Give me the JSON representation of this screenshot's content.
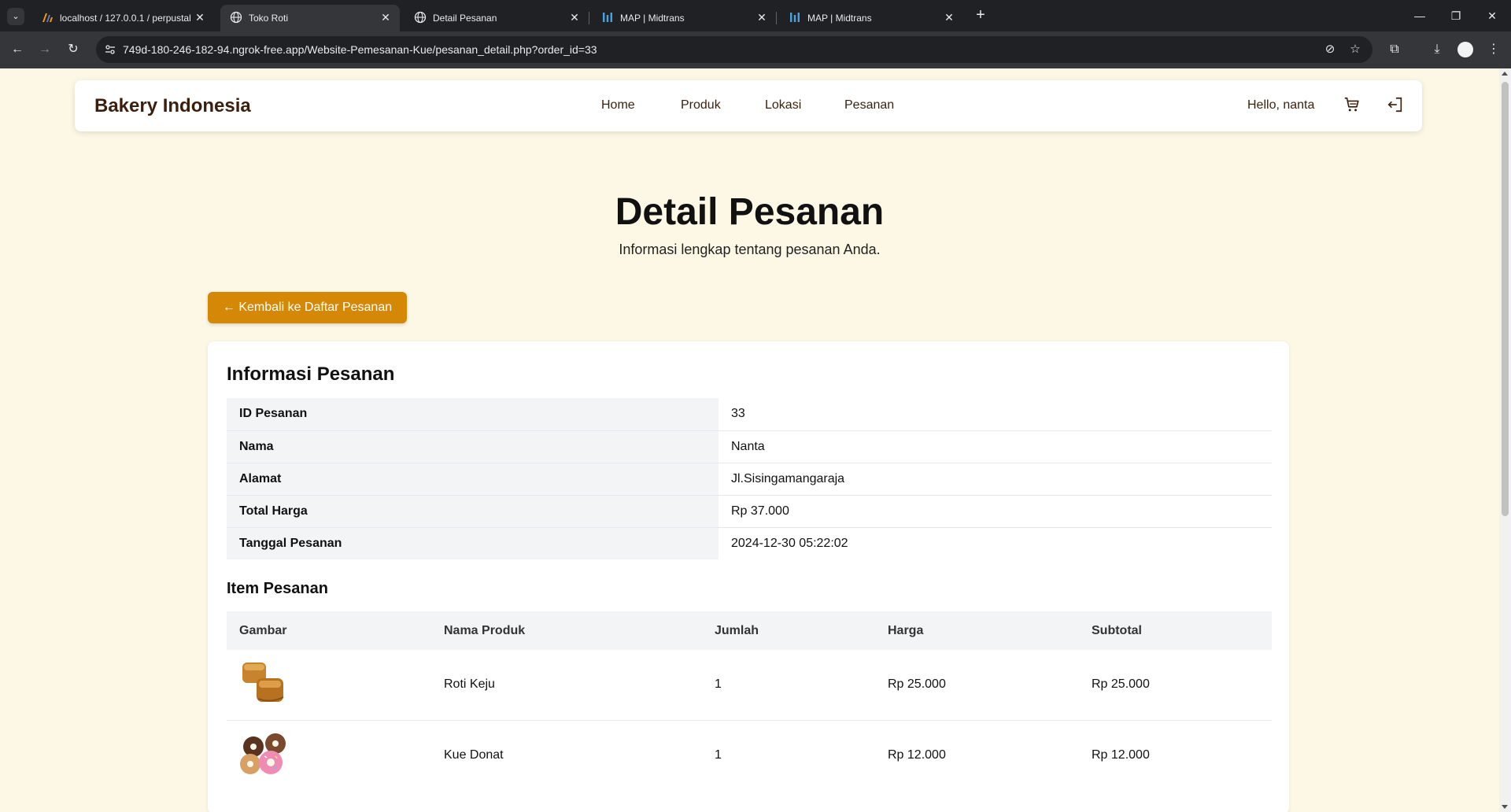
{
  "browser": {
    "tabs": [
      {
        "title": "localhost / 127.0.0.1 / perpustal",
        "active": false
      },
      {
        "title": "Toko Roti",
        "active": true
      },
      {
        "title": "Detail Pesanan",
        "active": false
      },
      {
        "title": "MAP | Midtrans",
        "active": false
      },
      {
        "title": "MAP | Midtrans",
        "active": false
      }
    ],
    "url": "749d-180-246-182-94.ngrok-free.app/Website-Pemesanan-Kue/pesanan_detail.php?order_id=33"
  },
  "navbar": {
    "brand": "Bakery Indonesia",
    "links": [
      "Home",
      "Produk",
      "Lokasi",
      "Pesanan"
    ],
    "greeting": "Hello, nanta"
  },
  "header": {
    "title": "Detail Pesanan",
    "subtitle": "Informasi lengkap tentang pesanan Anda."
  },
  "back_button": "← Kembali ke Daftar Pesanan",
  "order_info": {
    "heading": "Informasi Pesanan",
    "rows": [
      {
        "label": "ID Pesanan",
        "value": "33"
      },
      {
        "label": "Nama",
        "value": "Nanta"
      },
      {
        "label": "Alamat",
        "value": "Jl.Sisingamangaraja"
      },
      {
        "label": "Total Harga",
        "value": "Rp 37.000"
      },
      {
        "label": "Tanggal Pesanan",
        "value": "2024-12-30 05:22:02"
      }
    ]
  },
  "items": {
    "heading": "Item Pesanan",
    "columns": [
      "Gambar",
      "Nama Produk",
      "Jumlah",
      "Harga",
      "Subtotal"
    ],
    "rows": [
      {
        "image": "roti-keju-image",
        "name": "Roti Keju",
        "qty": "1",
        "price": "Rp 25.000",
        "subtotal": "Rp 25.000"
      },
      {
        "image": "kue-donat-image",
        "name": "Kue Donat",
        "qty": "1",
        "price": "Rp 12.000",
        "subtotal": "Rp 12.000"
      }
    ]
  },
  "colors": {
    "page_bg": "#fdf8e6",
    "brand_text": "#3b1f0c",
    "accent_button": "#d48806"
  }
}
